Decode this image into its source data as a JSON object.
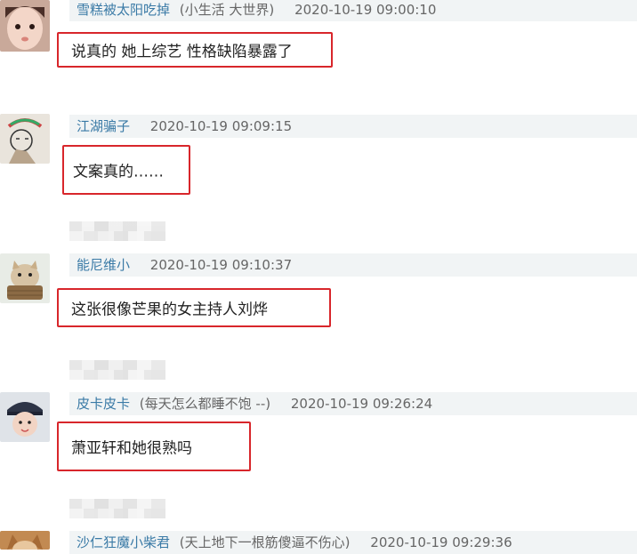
{
  "comments": [
    {
      "username": "雪糕被太阳吃掉",
      "signature": "(小生活 大世界)",
      "time": "2020-10-19 09:00:10",
      "reply": "说真的 她上综艺 性格缺陷暴露了",
      "avatar_icon": "child-face-avatar-icon"
    },
    {
      "username": "江湖骗子",
      "signature": "",
      "time": "2020-10-19 09:09:15",
      "reply": "文案真的……",
      "avatar_icon": "illustrated-girl-avatar-icon"
    },
    {
      "username": "能尼维小",
      "signature": "",
      "time": "2020-10-19 09:10:37",
      "reply": "这张很像芒果的女主持人刘烨",
      "avatar_icon": "cat-in-basket-avatar-icon"
    },
    {
      "username": "皮卡皮卡",
      "signature": "(每天怎么都睡不饱 --)",
      "time": "2020-10-19 09:26:24",
      "reply": "萧亚轩和她很熟吗",
      "avatar_icon": "child-in-uniform-avatar-icon"
    },
    {
      "username": "沙仁狂魔小柴君",
      "signature": "(天上地下一根筋傻逼不伤心)",
      "time": "2020-10-19 09:29:36",
      "reply": "",
      "avatar_icon": "shiba-dog-avatar-icon"
    }
  ],
  "colors": {
    "highlight_border": "#d8262b",
    "username": "#3a7aa6",
    "header_bg": "#f1f4f5"
  }
}
